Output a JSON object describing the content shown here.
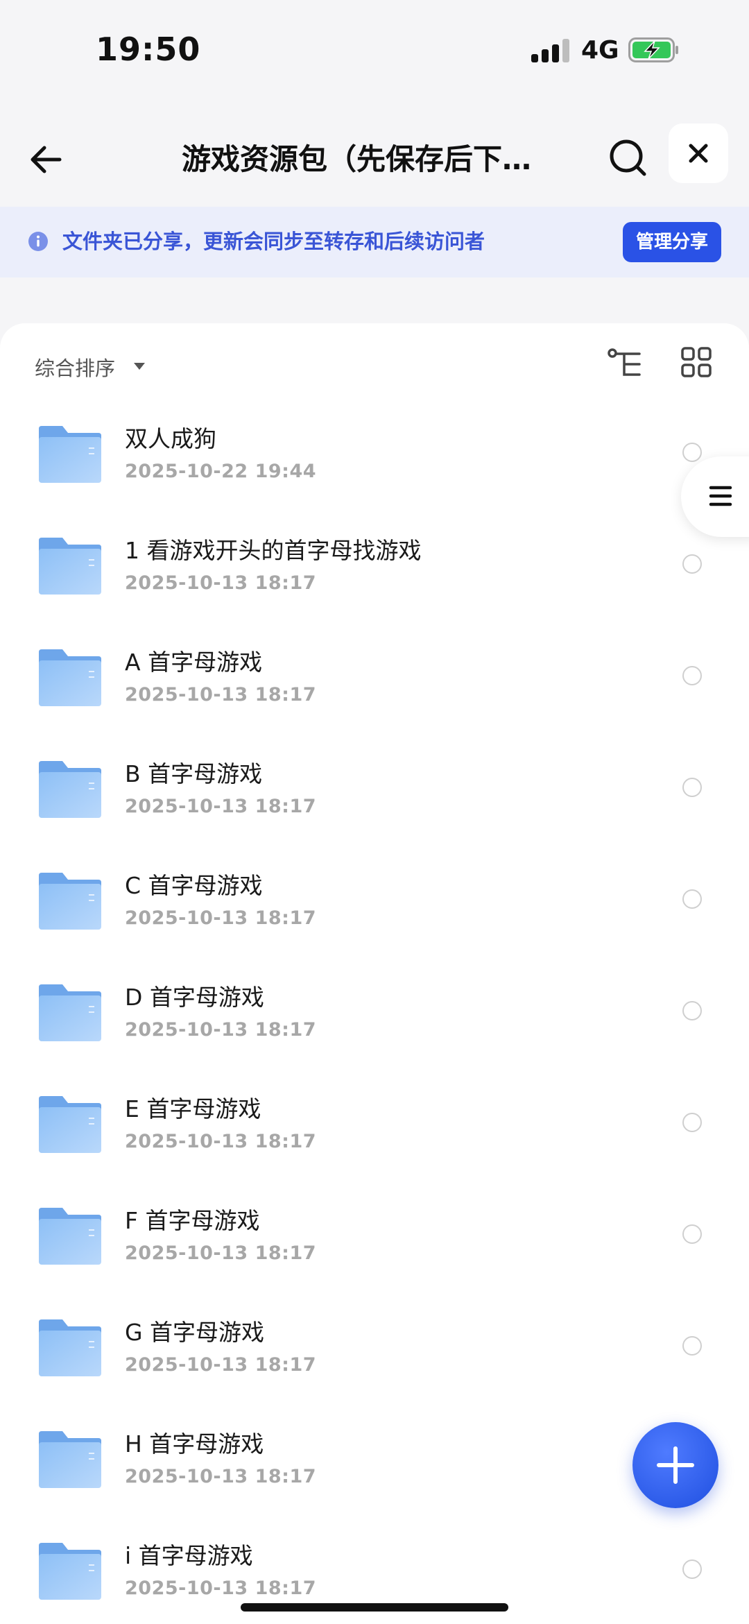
{
  "status_bar": {
    "time": "19:50",
    "network": "4G"
  },
  "header": {
    "title": "游戏资源包（先保存后下载..."
  },
  "notice": {
    "text": "文件夹已分享，更新会同步至转存和后续访问者",
    "button_label": "管理分享"
  },
  "toolbar": {
    "sort_label": "综合排序"
  },
  "files": [
    {
      "name": "双人成狗",
      "date": "2025-10-22 19:44"
    },
    {
      "name": "1 看游戏开头的首字母找游戏",
      "date": "2025-10-13 18:17"
    },
    {
      "name": "A 首字母游戏",
      "date": "2025-10-13 18:17"
    },
    {
      "name": "B 首字母游戏",
      "date": "2025-10-13 18:17"
    },
    {
      "name": "C 首字母游戏",
      "date": "2025-10-13 18:17"
    },
    {
      "name": "D 首字母游戏",
      "date": "2025-10-13 18:17"
    },
    {
      "name": "E 首字母游戏",
      "date": "2025-10-13 18:17"
    },
    {
      "name": "F 首字母游戏",
      "date": "2025-10-13 18:17"
    },
    {
      "name": "G 首字母游戏",
      "date": "2025-10-13 18:17"
    },
    {
      "name": "H 首字母游戏",
      "date": "2025-10-13 18:17"
    },
    {
      "name": "i 首字母游戏",
      "date": "2025-10-13 18:17"
    }
  ],
  "colors": {
    "accent": "#2a52e6",
    "notice_bg": "#ebeefb",
    "folder": "#7fb4f2"
  }
}
